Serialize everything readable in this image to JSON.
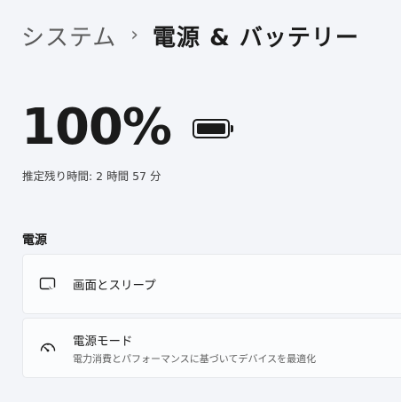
{
  "breadcrumb": {
    "parent": "システム",
    "separator": "›",
    "current": "電源 & バッテリー"
  },
  "battery": {
    "percent_label": "100%",
    "level": 1.0,
    "remaining_label": "推定残り時間: 2 時間 57 分"
  },
  "power_section": {
    "title": "電源",
    "items": [
      {
        "title": "画面とスリープ",
        "icon": "screen-sleep-icon"
      },
      {
        "title": "電源モード",
        "subtitle": "電力消費とパフォーマンスに基づいてデバイスを最適化",
        "icon": "gauge-icon"
      }
    ]
  }
}
